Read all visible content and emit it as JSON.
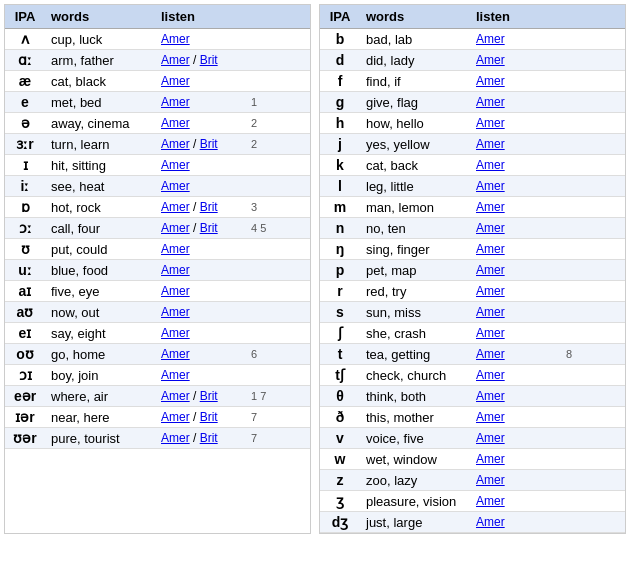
{
  "leftTable": {
    "headers": [
      "IPA",
      "words",
      "listen"
    ],
    "rows": [
      {
        "ipa": "ʌ",
        "words": "cup, luck",
        "amer": "Amer",
        "brit": null,
        "notes": ""
      },
      {
        "ipa": "ɑː",
        "words": "arm, father",
        "amer": "Amer",
        "brit": "Brit",
        "notes": ""
      },
      {
        "ipa": "æ",
        "words": "cat, black",
        "amer": "Amer",
        "brit": null,
        "notes": ""
      },
      {
        "ipa": "e",
        "words": "met, bed",
        "amer": "Amer",
        "brit": null,
        "notes": "1"
      },
      {
        "ipa": "ə",
        "words": "away, cinema",
        "amer": "Amer",
        "brit": null,
        "notes": "2"
      },
      {
        "ipa": "ɜːr",
        "words": "turn, learn",
        "amer": "Amer",
        "brit": "Brit",
        "notes": "2"
      },
      {
        "ipa": "ɪ",
        "words": "hit, sitting",
        "amer": "Amer",
        "brit": null,
        "notes": ""
      },
      {
        "ipa": "iː",
        "words": "see, heat",
        "amer": "Amer",
        "brit": null,
        "notes": ""
      },
      {
        "ipa": "ɒ",
        "words": "hot, rock",
        "amer": "Amer",
        "brit": "Brit",
        "notes": "3"
      },
      {
        "ipa": "ɔː",
        "words": "call, four",
        "amer": "Amer",
        "brit": "Brit",
        "notes": "4 5"
      },
      {
        "ipa": "ʊ",
        "words": "put, could",
        "amer": "Amer",
        "brit": null,
        "notes": ""
      },
      {
        "ipa": "uː",
        "words": "blue, food",
        "amer": "Amer",
        "brit": null,
        "notes": ""
      },
      {
        "ipa": "aɪ",
        "words": "five, eye",
        "amer": "Amer",
        "brit": null,
        "notes": ""
      },
      {
        "ipa": "aʊ",
        "words": "now, out",
        "amer": "Amer",
        "brit": null,
        "notes": ""
      },
      {
        "ipa": "eɪ",
        "words": "say, eight",
        "amer": "Amer",
        "brit": null,
        "notes": ""
      },
      {
        "ipa": "oʊ",
        "words": "go, home",
        "amer": "Amer",
        "brit": null,
        "notes": "6"
      },
      {
        "ipa": "ɔɪ",
        "words": "boy, join",
        "amer": "Amer",
        "brit": null,
        "notes": ""
      },
      {
        "ipa": "eər",
        "words": "where, air",
        "amer": "Amer",
        "brit": "Brit",
        "notes": "1 7"
      },
      {
        "ipa": "ɪər",
        "words": "near, here",
        "amer": "Amer",
        "brit": "Brit",
        "notes": "7"
      },
      {
        "ipa": "ʊər",
        "words": "pure, tourist",
        "amer": "Amer",
        "brit": "Brit",
        "notes": "7"
      }
    ]
  },
  "rightTable": {
    "headers": [
      "IPA",
      "words",
      "listen"
    ],
    "rows": [
      {
        "ipa": "b",
        "words": "bad, lab",
        "amer": "Amer",
        "brit": null,
        "notes": ""
      },
      {
        "ipa": "d",
        "words": "did, lady",
        "amer": "Amer",
        "brit": null,
        "notes": ""
      },
      {
        "ipa": "f",
        "words": "find, if",
        "amer": "Amer",
        "brit": null,
        "notes": ""
      },
      {
        "ipa": "g",
        "words": "give, flag",
        "amer": "Amer",
        "brit": null,
        "notes": ""
      },
      {
        "ipa": "h",
        "words": "how, hello",
        "amer": "Amer",
        "brit": null,
        "notes": ""
      },
      {
        "ipa": "j",
        "words": "yes, yellow",
        "amer": "Amer",
        "brit": null,
        "notes": ""
      },
      {
        "ipa": "k",
        "words": "cat, back",
        "amer": "Amer",
        "brit": null,
        "notes": ""
      },
      {
        "ipa": "l",
        "words": "leg, little",
        "amer": "Amer",
        "brit": null,
        "notes": ""
      },
      {
        "ipa": "m",
        "words": "man, lemon",
        "amer": "Amer",
        "brit": null,
        "notes": ""
      },
      {
        "ipa": "n",
        "words": "no, ten",
        "amer": "Amer",
        "brit": null,
        "notes": ""
      },
      {
        "ipa": "ŋ",
        "words": "sing, finger",
        "amer": "Amer",
        "brit": null,
        "notes": ""
      },
      {
        "ipa": "p",
        "words": "pet, map",
        "amer": "Amer",
        "brit": null,
        "notes": ""
      },
      {
        "ipa": "r",
        "words": "red, try",
        "amer": "Amer",
        "brit": null,
        "notes": ""
      },
      {
        "ipa": "s",
        "words": "sun, miss",
        "amer": "Amer",
        "brit": null,
        "notes": ""
      },
      {
        "ipa": "ʃ",
        "words": "she, crash",
        "amer": "Amer",
        "brit": null,
        "notes": ""
      },
      {
        "ipa": "t",
        "words": "tea, getting",
        "amer": "Amer",
        "brit": null,
        "notes": "8"
      },
      {
        "ipa": "tʃ",
        "words": "check, church",
        "amer": "Amer",
        "brit": null,
        "notes": ""
      },
      {
        "ipa": "θ",
        "words": "think, both",
        "amer": "Amer",
        "brit": null,
        "notes": ""
      },
      {
        "ipa": "ð",
        "words": "this, mother",
        "amer": "Amer",
        "brit": null,
        "notes": ""
      },
      {
        "ipa": "v",
        "words": "voice, five",
        "amer": "Amer",
        "brit": null,
        "notes": ""
      },
      {
        "ipa": "w",
        "words": "wet, window",
        "amer": "Amer",
        "brit": null,
        "notes": ""
      },
      {
        "ipa": "z",
        "words": "zoo, lazy",
        "amer": "Amer",
        "brit": null,
        "notes": ""
      },
      {
        "ipa": "ʒ",
        "words": "pleasure, vision",
        "amer": "Amer",
        "brit": null,
        "notes": ""
      },
      {
        "ipa": "dʒ",
        "words": "just, large",
        "amer": "Amer",
        "brit": null,
        "notes": ""
      }
    ]
  },
  "labels": {
    "ipa": "IPA",
    "words": "words",
    "listen": "listen",
    "amer": "Amer",
    "brit": "Brit",
    "separator": " / "
  }
}
